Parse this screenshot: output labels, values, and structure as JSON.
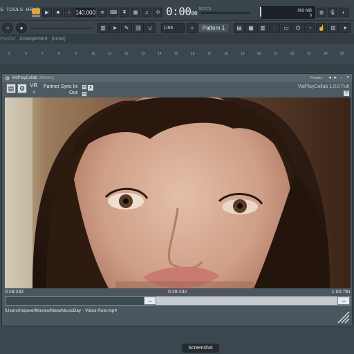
{
  "menu": {
    "tools": "TOOLS",
    "help": "HELP",
    "prefix": "S"
  },
  "transport": {
    "tempo": "140.000",
    "time": "0:00",
    "time_sub": "00",
    "time_unit_label": "M:S:CS"
  },
  "cpu": {
    "memory": "906 MB",
    "polyphony": "0"
  },
  "toolbar2": {
    "snap": "Line",
    "pattern": "Pattern 1"
  },
  "playlist": {
    "label": "Playlist",
    "arrangement": "Arrangement",
    "none": "(none)"
  },
  "ruler_ticks": [
    "5",
    "6",
    "7",
    "8",
    "9",
    "10",
    "11",
    "12",
    "13",
    "14",
    "15",
    "16",
    "17",
    "18",
    "19",
    "20",
    "21",
    "22",
    "23",
    "24",
    "25"
  ],
  "plugin": {
    "title": "VidPlayCollab",
    "title_sub": "(Master)",
    "presets": "Presets",
    "version": "VidPlayCollab 1.0.0 Full",
    "vr_label": "VR",
    "partner_sync": "Partner Sync In:",
    "out_label": "Out:",
    "help": "?",
    "timeline": {
      "start": "0:28:232",
      "current": "0:28:232",
      "end": "1:04:791",
      "progress": 0.438
    },
    "file_path": "/Users/mojave/Movies/MakeMusicDay - Video Reel.mp4"
  },
  "footer": {
    "screenshot": "Screenshot"
  },
  "colors": {
    "accent": "#e7a33a",
    "record": "#d23b3b",
    "background": "#3e4a52"
  }
}
